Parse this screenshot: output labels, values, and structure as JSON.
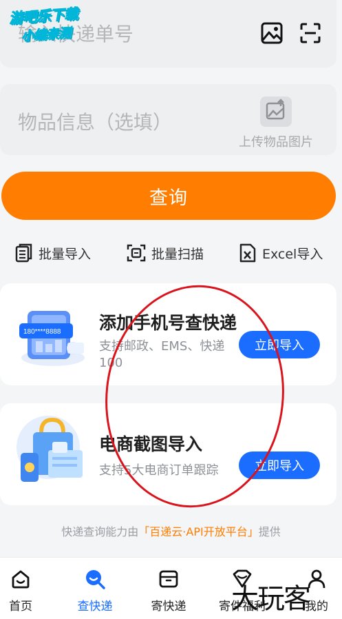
{
  "tracking": {
    "placeholder": "输入快递单号"
  },
  "goods": {
    "placeholder": "物品信息（选填）",
    "upload_label": "上传物品图片"
  },
  "query_button": "查询",
  "actions": [
    {
      "label": "批量导入",
      "icon": "list-icon"
    },
    {
      "label": "批量扫描",
      "icon": "scan-frame-icon"
    },
    {
      "label": "Excel导入",
      "icon": "excel-icon"
    }
  ],
  "promo_phone": {
    "title": "添加手机号查快递",
    "subtitle_line1": "支持邮政、EMS、快递",
    "subtitle_line2": "100",
    "button": "立即导入",
    "phone_text": "180****8888"
  },
  "promo_ecommerce": {
    "title": "电商截图导入",
    "subtitle": "支持5大电商订单跟踪",
    "button": "立即导入"
  },
  "footer": {
    "prefix": "快递查询能力由",
    "brand": "「百递云·API开放平台」",
    "suffix": "提供"
  },
  "tabs": [
    {
      "label": "首页",
      "icon": "home-icon",
      "active": false
    },
    {
      "label": "查快递",
      "icon": "search-icon",
      "active": true
    },
    {
      "label": "寄快递",
      "icon": "box-icon",
      "active": false
    },
    {
      "label": "寄件福利",
      "icon": "gift-icon",
      "active": false
    },
    {
      "label": "我的",
      "icon": "user-icon",
      "active": false
    }
  ],
  "watermark": {
    "line1": "游吧乐下载",
    "line2": "小编亲测"
  },
  "corner_mark": "大玩客",
  "colors": {
    "accent": "#ff7d00",
    "primary": "#1a6dff",
    "annotation": "#d9141c"
  }
}
